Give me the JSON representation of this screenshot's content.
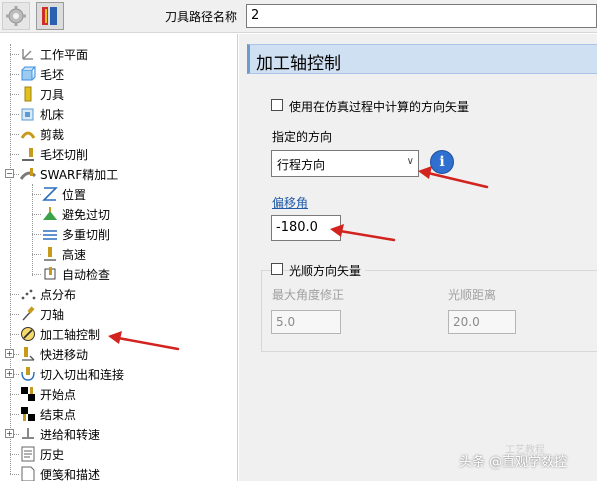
{
  "toolbar": {
    "path_label": "刀具路径名称",
    "path_value": "2"
  },
  "tree": {
    "items": [
      {
        "label": "工作平面",
        "icon": "workplane-icon",
        "color": "#8b8b8b"
      },
      {
        "label": "毛坯",
        "icon": "stock-icon",
        "color": "#3b8de0"
      },
      {
        "label": "刀具",
        "icon": "tool-icon",
        "color": "#e1c11b"
      },
      {
        "label": "机床",
        "icon": "machine-icon",
        "color": "#5a9bd5"
      },
      {
        "label": "剪裁",
        "icon": "trim-icon",
        "color": "#c89a1b"
      },
      {
        "label": "毛坯切削",
        "icon": "stock-cut-icon",
        "color": "#c89a1b"
      },
      {
        "label": "SWARF精加工",
        "icon": "swarf-finishing-icon",
        "color": "#7a7a7a"
      },
      {
        "label": "位置",
        "icon": "position-icon",
        "color": "#2b6fbf"
      },
      {
        "label": "避免过切",
        "icon": "avoid-gouge-icon",
        "color": "#3aa34a"
      },
      {
        "label": "多重切削",
        "icon": "multiple-cuts-icon",
        "color": "#2b6fbf"
      },
      {
        "label": "高速",
        "icon": "high-speed-icon",
        "color": "#c89a1b"
      },
      {
        "label": "自动检查",
        "icon": "auto-verify-icon",
        "color": "#c89a1b"
      },
      {
        "label": "点分布",
        "icon": "point-distribution-icon",
        "color": "#555555"
      },
      {
        "label": "刀轴",
        "icon": "tool-axis-icon",
        "color": "#c89a1b"
      },
      {
        "label": "加工轴控制",
        "icon": "machine-axis-control-icon",
        "color": "#c89a1b"
      },
      {
        "label": "快进移动",
        "icon": "rapid-move-icon",
        "color": "#c89a1b"
      },
      {
        "label": "切入切出和连接",
        "icon": "leads-links-icon",
        "color": "#c89a1b"
      },
      {
        "label": "开始点",
        "icon": "start-point-icon",
        "color": "#000000"
      },
      {
        "label": "结束点",
        "icon": "end-point-icon",
        "color": "#000000"
      },
      {
        "label": "进给和转速",
        "icon": "feeds-speeds-icon",
        "color": "#888888"
      },
      {
        "label": "历史",
        "icon": "history-icon",
        "color": "#666666"
      },
      {
        "label": "便笺和描述",
        "icon": "notes-icon",
        "color": "#666666"
      }
    ]
  },
  "panel": {
    "title": "加工轴控制",
    "use_direction_label": "使用在仿真过程中计算的方向矢量",
    "specified_direction_label": "指定的方向",
    "direction_value": "行程方向",
    "info_glyph": "i",
    "offset_angle_label": "偏移角",
    "offset_angle_value": "-180.0",
    "smooth_direction_label": "光顺方向矢量",
    "max_angle_label": "最大角度修正",
    "max_angle_value": "5.0",
    "smooth_distance_label": "光顺距离",
    "smooth_distance_value": "20.0"
  },
  "watermark": {
    "text": "头条 @直观学数控",
    "faint": "工艺教程"
  },
  "colors": {
    "accent": "#2e6fd0",
    "header_bg": "#cfe0f2",
    "arrow": "#d2231f",
    "link": "#1e5aa8"
  }
}
